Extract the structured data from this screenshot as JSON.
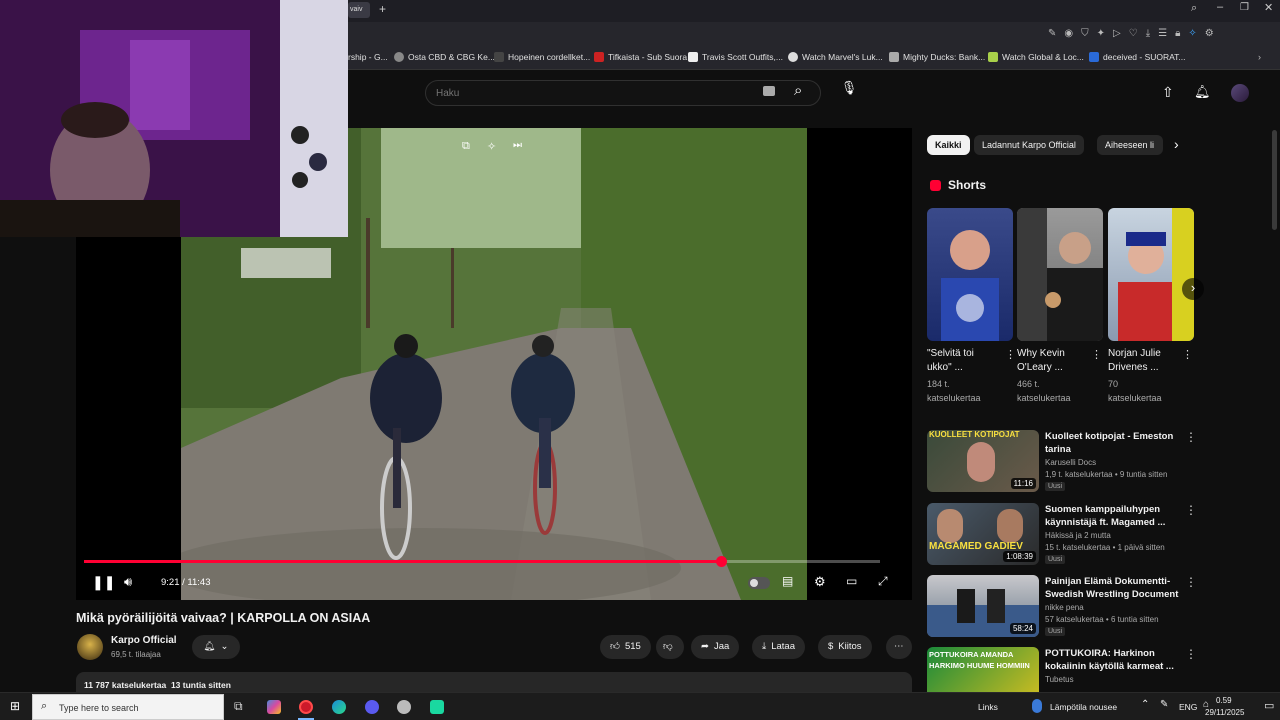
{
  "browser": {
    "tab_label": "vaiv",
    "bookmarks": [
      {
        "label": "rship - G...",
        "color": "#3a3a3a"
      },
      {
        "label": "Osta CBD & CBG Ke...",
        "color": "#888888"
      },
      {
        "label": "Hopeinen cordellket...",
        "color": "#444444"
      },
      {
        "label": "Tifkaista - Sub Suora",
        "color": "#cc2222"
      },
      {
        "label": "Travis Scott Outfits,...",
        "color": "#eeeeee"
      },
      {
        "label": "Watch Marvel's Luk...",
        "color": "#dddddd"
      },
      {
        "label": "Mighty Ducks: Bank...",
        "color": "#aaaaaa"
      },
      {
        "label": "Watch Global & Loc...",
        "color": "#a8d04a"
      },
      {
        "label": "deceived - SUORAT...",
        "color": "#2a6ad8"
      }
    ]
  },
  "youtube": {
    "search_placeholder": "Haku",
    "player": {
      "time": "9:21 / 11:43",
      "progress": 0.8
    },
    "video_title": "Mikä pyöräilijöitä vaivaa? | KARPOLLA ON ASIAA",
    "channel": {
      "name": "Karpo Official",
      "subs": "69,5 t. tilaajaa"
    },
    "actions": {
      "likes": "515",
      "share": "Jaa",
      "download": "Lataa",
      "thanks": "Kiitos"
    },
    "description_meta": "11 787 katselukertaa  13 tuntia sitten",
    "chips": [
      "Kaikki",
      "Ladannut Karpo Official",
      "Aiheeseen li"
    ],
    "shorts_heading": "Shorts",
    "shorts": [
      {
        "title": "\"Selvitä toi ukko\" ...",
        "views": "184 t.",
        "views_label": "katselukertaa"
      },
      {
        "title": "Why Kevin O'Leary ...",
        "views": "466 t.",
        "views_label": "katselukertaa"
      },
      {
        "title": "Norjan Julie Drivenes ...",
        "views": "70",
        "views_label": "katselukertaa"
      }
    ],
    "recommendations": [
      {
        "title": "Kuolleet kotipojat - Emeston tarina",
        "channel": "Karuselli Docs",
        "meta": "1,9 t. katselukertaa • 9 tuntia sitten",
        "badge": "Uusi",
        "duration": "11:16",
        "thumb_text": "KUOLLEET KOTIPOJAT"
      },
      {
        "title": "Suomen kamppailuhypen käynnistäjä ft. Magamed ...",
        "channel": "Häkissä ja 2 mutta",
        "meta": "15 t. katselukertaa • 1 päivä sitten",
        "badge": "Uusi",
        "duration": "1:08:39",
        "thumb_text": "MAGAMED GADIEV"
      },
      {
        "title": "Painijan Elämä Dokumentti- Swedish Wrestling Document",
        "channel": "nikke pena",
        "meta": "57 katselukertaa • 6 tuntia sitten",
        "badge": "Uusi",
        "duration": "58:24",
        "thumb_text": ""
      },
      {
        "title": "POTTUKOIRA: Harkinon kokaiinin käytöllä karmeat ...",
        "channel": "Tubetus",
        "meta": "",
        "badge": "",
        "duration": "",
        "thumb_text": "POTTUKOIRA AMANDA HARKIMO HUUME HOMMIIN"
      }
    ]
  },
  "taskbar": {
    "search_placeholder": "Type here to search",
    "links": "Links",
    "weather": "Lämpötila nousee",
    "lang": "ENG",
    "time": "0.59",
    "date": "29/11/2025"
  },
  "colors": {
    "accent": "#ff0033",
    "bg": "#0f0f0f"
  }
}
